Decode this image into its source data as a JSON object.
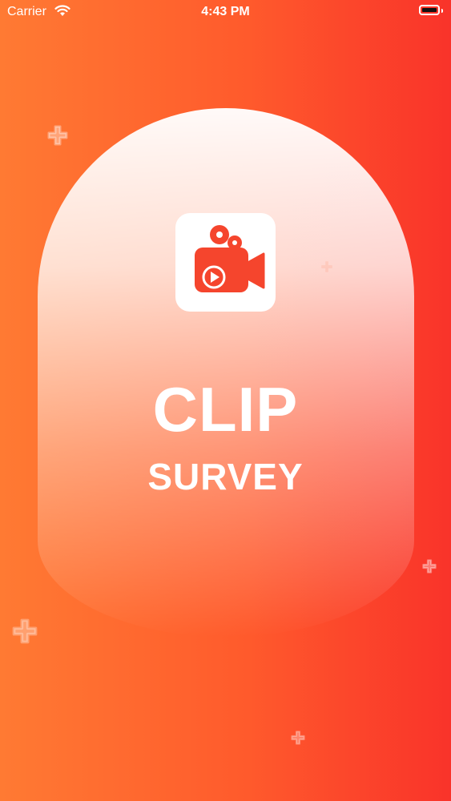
{
  "status_bar": {
    "carrier": "Carrier",
    "time": "4:43 PM"
  },
  "splash": {
    "title": "CLIP",
    "subtitle": "SURVEY"
  },
  "icons": {
    "app_logo": "video-camera-play-icon",
    "decor": "plus-sparkle-icon",
    "wifi": "wifi-icon",
    "battery": "battery-icon"
  },
  "colors": {
    "gradient_left": "#ff7a33",
    "gradient_right": "#f9332a",
    "logo": "#f5452d",
    "text": "#ffffff"
  }
}
